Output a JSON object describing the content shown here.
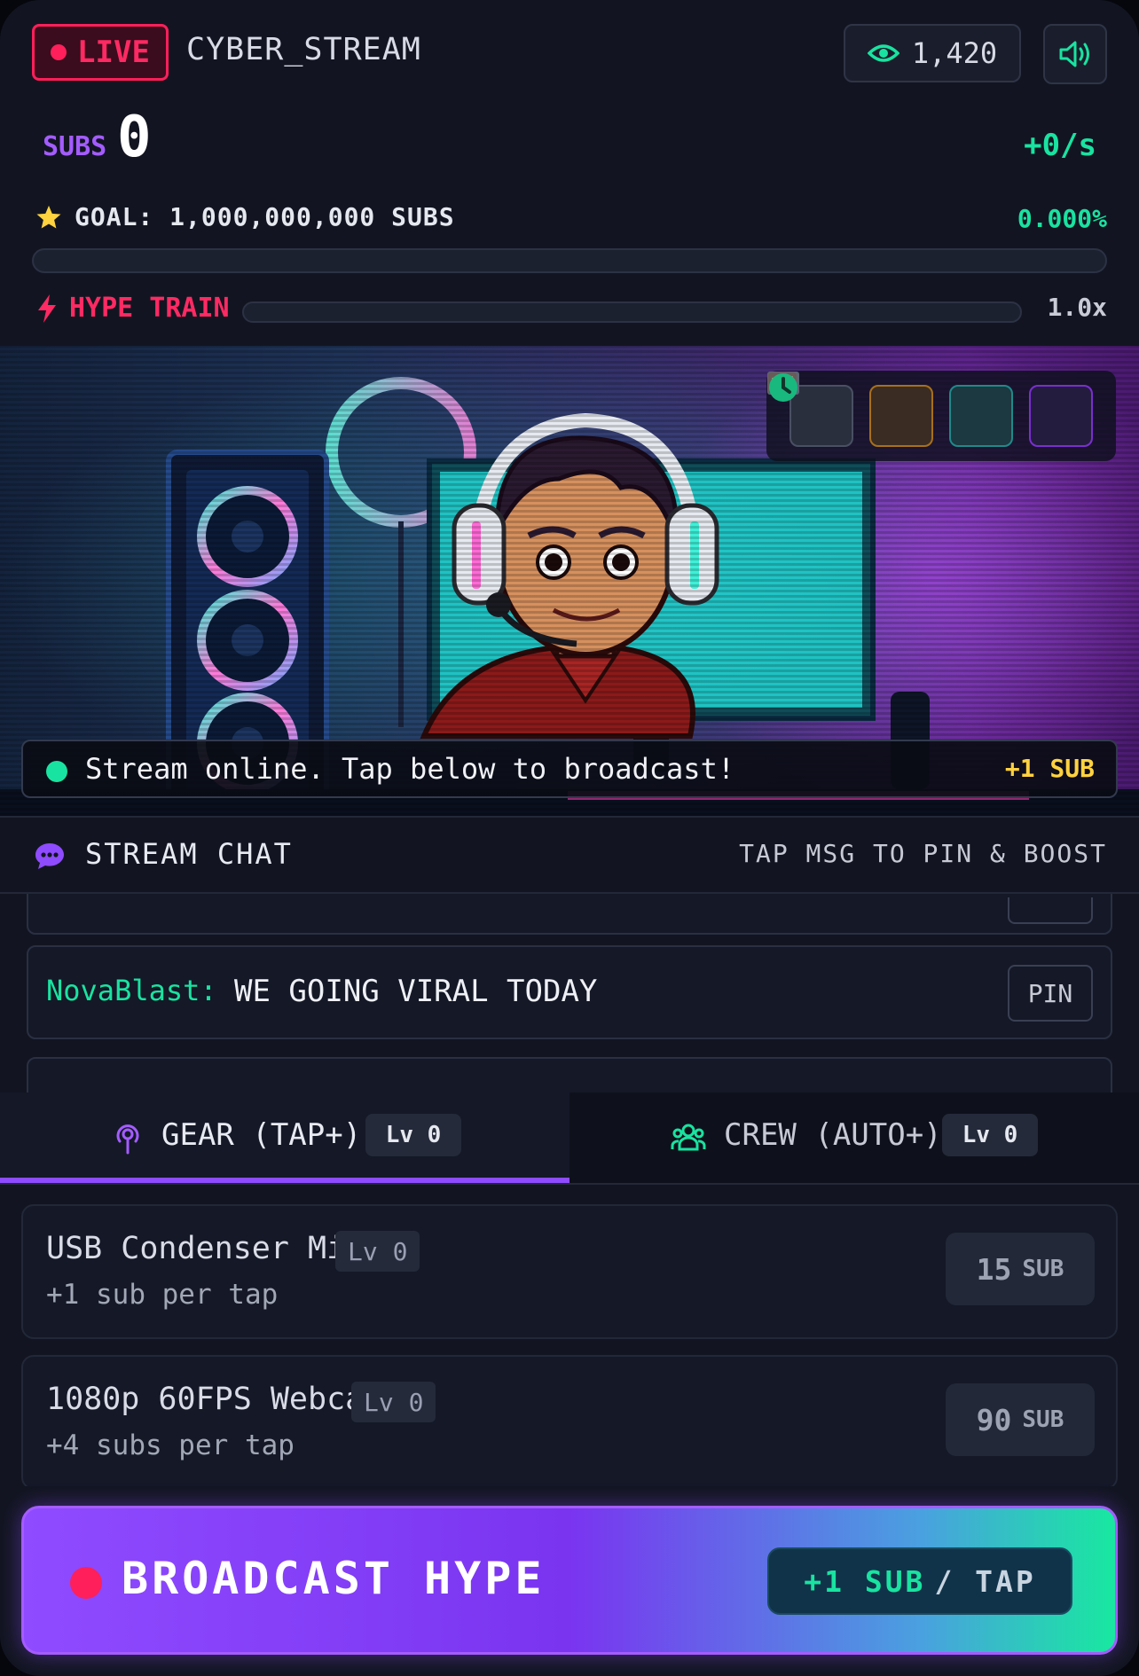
{
  "header": {
    "live_label": "LIVE",
    "channel_name": "CYBER_STREAM",
    "viewer_count": "1,420",
    "subs_label": "SUBS",
    "subs_count": "0",
    "rate": "+0/s",
    "goal_label": "GOAL: 1,000,000,000 SUBS",
    "goal_percent": "0.000%",
    "goal_progress": 0,
    "hype_label": "HYPE TRAIN",
    "hype_progress": 0,
    "multiplier": "1.0x"
  },
  "stream": {
    "status_text": "Stream online. Tap below to broadcast!",
    "gain_text": "+1 SUB",
    "tools": [
      "video-icon",
      "chat-bubble-icon",
      "pixel-image-icon",
      "clock-icon"
    ]
  },
  "chat": {
    "title": "STREAM CHAT",
    "hint": "TAP MSG TO PIN & BOOST",
    "messages": [
      {
        "user": "NovaBlast:",
        "text": "WE GOING VIRAL TODAY",
        "pin_label": "PIN"
      }
    ]
  },
  "tabs": [
    {
      "label": "GEAR (TAP+)",
      "level": "Lv 0",
      "icon": "podcast-mic-icon",
      "active": true
    },
    {
      "label": "CREW (AUTO+)",
      "level": "Lv 0",
      "icon": "users-group-icon",
      "active": false
    }
  ],
  "upgrades": [
    {
      "name": "USB Condenser Mic",
      "level": "Lv 0",
      "desc": "+1 sub per tap",
      "cost": "15",
      "unit": "SUB"
    },
    {
      "name": "1080p 60FPS Webcam",
      "level": "Lv 0",
      "desc": "+4 subs per tap",
      "cost": "90",
      "unit": "SUB"
    }
  ],
  "broadcast": {
    "label": "BROADCAST HYPE",
    "gain": "+1 SUB",
    "per": "/ TAP"
  },
  "colors": {
    "accent_purple": "#8f4bff",
    "accent_green": "#19e3a0",
    "live_red": "#ff1f5a",
    "gold": "#ffd23f"
  }
}
